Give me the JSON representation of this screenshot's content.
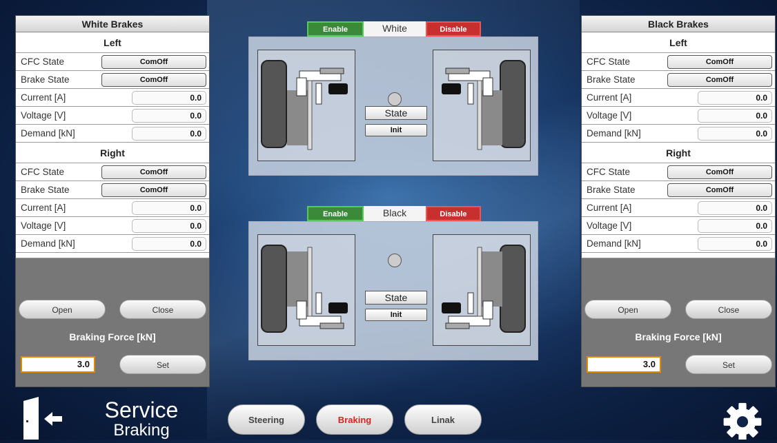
{
  "white_panel": {
    "title": "White Brakes",
    "left_section": "Left",
    "right_section": "Right",
    "left": {
      "cfc_label": "CFC State",
      "cfc_value": "ComOff",
      "brake_label": "Brake State",
      "brake_value": "ComOff",
      "current_label": "Current [A]",
      "current_value": "0.0",
      "voltage_label": "Voltage [V]",
      "voltage_value": "0.0",
      "demand_label": "Demand [kN]",
      "demand_value": "0.0"
    },
    "right": {
      "cfc_label": "CFC State",
      "cfc_value": "ComOff",
      "brake_label": "Brake State",
      "brake_value": "ComOff",
      "current_label": "Current [A]",
      "current_value": "0.0",
      "voltage_label": "Voltage [V]",
      "voltage_value": "0.0",
      "demand_label": "Demand [kN]",
      "demand_value": "0.0"
    },
    "open_label": "Open",
    "close_label": "Close",
    "force_label": "Braking Force [kN]",
    "force_value": "3.0",
    "set_label": "Set"
  },
  "black_panel": {
    "title": "Black Brakes",
    "left_section": "Left",
    "right_section": "Right",
    "left": {
      "cfc_label": "CFC State",
      "cfc_value": "ComOff",
      "brake_label": "Brake State",
      "brake_value": "ComOff",
      "current_label": "Current [A]",
      "current_value": "0.0",
      "voltage_label": "Voltage [V]",
      "voltage_value": "0.0",
      "demand_label": "Demand [kN]",
      "demand_value": "0.0"
    },
    "right": {
      "cfc_label": "CFC State",
      "cfc_value": "ComOff",
      "brake_label": "Brake State",
      "brake_value": "ComOff",
      "current_label": "Current [A]",
      "current_value": "0.0",
      "voltage_label": "Voltage [V]",
      "voltage_value": "0.0",
      "demand_label": "Demand [kN]",
      "demand_value": "0.0"
    },
    "open_label": "Open",
    "close_label": "Close",
    "force_label": "Braking Force [kN]",
    "force_value": "3.0",
    "set_label": "Set"
  },
  "white_unit": {
    "enable": "Enable",
    "name": "White",
    "disable": "Disable",
    "state_label": "State",
    "state_value": "Init"
  },
  "black_unit": {
    "enable": "Enable",
    "name": "Black",
    "disable": "Disable",
    "state_label": "State",
    "state_value": "Init"
  },
  "nav": {
    "steering": "Steering",
    "braking": "Braking",
    "linak": "Linak"
  },
  "screen": {
    "title_line1": "Service",
    "title_line2": "Braking"
  },
  "colors": {
    "enable": "#3a8a3a",
    "disable": "#c83030",
    "active_nav": "#e02020",
    "input_border": "#e08a00"
  },
  "icons": {
    "exit": "exit-door-icon",
    "settings": "gear-icon"
  }
}
